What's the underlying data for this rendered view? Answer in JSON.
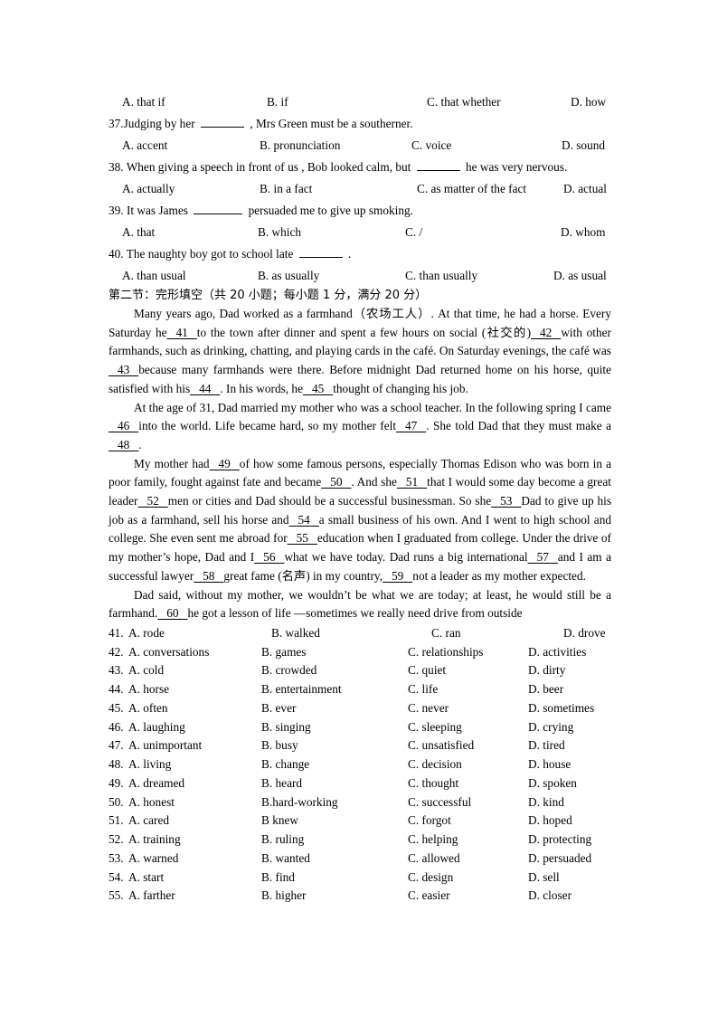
{
  "part1": {
    "q36_options": {
      "A": "A. that if",
      "B": "B. if",
      "C": "C. that whether",
      "D": "D. how"
    },
    "questions": [
      {
        "number": "37.",
        "before": "Judging by her",
        "after": ", Mrs Green must be a southerner.",
        "options": {
          "A": "A. accent",
          "B": "B. pronunciation",
          "C": "C. voice",
          "D": "D. sound"
        }
      },
      {
        "number": "38.",
        "before": "When giving a speech in front of us , Bob looked calm, but",
        "after": "he was very nervous.",
        "options": {
          "A": "A. actually",
          "B": "B. in a fact",
          "C": "C. as matter of the fact",
          "D": "D. actual"
        }
      },
      {
        "number": "39.",
        "before": "It was James",
        "after": "persuaded me to give up smoking.",
        "options": {
          "A": "A. that",
          "B": "B. which",
          "C": "C. /",
          "D": "D. whom"
        }
      },
      {
        "number": "40.",
        "before": "The naughty boy got to school late",
        "after": ".",
        "options": {
          "A": "A. than usual",
          "B": "B. as usually",
          "C": "C. than usually",
          "D": "D. as usual"
        }
      }
    ]
  },
  "part2": {
    "heading": "第二节：完形填空（共 20 小题；每小题 1 分，满分 20 分）",
    "paragraphs": [
      {
        "segments": [
          "Many years ago, Dad worked as a farmhand（农场工人）. At that time, he had a horse. Every Saturday he",
          "41",
          "to the town after dinner and spent a few hours on social (社交的)",
          "42",
          "with other farmhands, such as drinking, chatting, and playing cards in the café. On Saturday evenings, the café was",
          "43",
          "because many farmhands were there. Before midnight Dad returned home on his horse, quite satisfied with his",
          "44",
          ". In his words, he",
          "45",
          "thought of changing his job."
        ]
      },
      {
        "segments": [
          "At the age of 31, Dad married my mother who was a school teacher. In the following spring I came",
          "46",
          "into the world. Life became hard, so my mother felt",
          "47",
          ". She told Dad that they must make a",
          "48",
          "."
        ]
      },
      {
        "segments": [
          "My mother had",
          "49",
          "of how some famous persons, especially Thomas Edison who was born in a poor family, fought against fate and became",
          "50",
          ". And she",
          "51",
          "that I would some day become a great leader",
          "52",
          "men or cities and Dad should be a successful businessman. So she",
          "53",
          "Dad to give up his job as a farmhand, sell his horse and",
          "54",
          "a small business of his own. And I went to high school and college. She even sent me abroad for",
          "55",
          "education when I graduated from college. Under the drive of my mother’s hope, Dad and I",
          "56",
          "what we have today. Dad runs a big international",
          "57",
          "and I am a successful lawyer",
          "58",
          "great fame (名声) in my country,",
          "59",
          "not a leader as my mother expected."
        ]
      },
      {
        "segments": [
          "Dad said, without my mother, we wouldn’t be what we are today; at least, he would still be a farmhand.",
          "60",
          "he got a lesson of life —sometimes we really need drive from outside"
        ]
      }
    ],
    "answers": [
      {
        "n": "41.",
        "A": "A. rode",
        "B": "B. walked",
        "C": "C. ran",
        "D": "D. drove"
      },
      {
        "n": "42.",
        "A": "A. conversations",
        "B": "B. games",
        "C": "C. relationships",
        "D": "D. activities"
      },
      {
        "n": "43.",
        "A": "A. cold",
        "B": "B. crowded",
        "C": "C. quiet",
        "D": "D. dirty"
      },
      {
        "n": "44.",
        "A": "A. horse",
        "B": "B. entertainment",
        "C": "C. life",
        "D": "D. beer"
      },
      {
        "n": "45.",
        "A": "A. often",
        "B": "B. ever",
        "C": "C. never",
        "D": "D. sometimes"
      },
      {
        "n": "46.",
        "A": "A. laughing",
        "B": "B. singing",
        "C": "C. sleeping",
        "D": "D. crying"
      },
      {
        "n": "47.",
        "A": "A. unimportant",
        "B": "B. busy",
        "C": "C. unsatisfied",
        "D": "D. tired"
      },
      {
        "n": "48.",
        "A": "A. living",
        "B": "B. change",
        "C": "C. decision",
        "D": "D. house"
      },
      {
        "n": "49.",
        "A": "A. dreamed",
        "B": "B. heard",
        "C": "C. thought",
        "D": "D. spoken"
      },
      {
        "n": "50.",
        "A": "A. honest",
        "B": "B.hard-working",
        "C": "C. successful",
        "D": "D. kind"
      },
      {
        "n": "51.",
        "A": "A. cared",
        "B": "B knew",
        "C": "C. forgot",
        "D": "D. hoped"
      },
      {
        "n": "52.",
        "A": "A. training",
        "B": "B. ruling",
        "C": "C. helping",
        "D": "D. protecting"
      },
      {
        "n": "53.",
        "A": "A. warned",
        "B": "B. wanted",
        "C": "C. allowed",
        "D": "D. persuaded"
      },
      {
        "n": "54.",
        "A": "A. start",
        "B": "B. find",
        "C": "C. design",
        "D": "D. sell"
      },
      {
        "n": "55.",
        "A": "A. farther",
        "B": "B. higher",
        "C": "C. easier",
        "D": "D. closer"
      }
    ]
  }
}
